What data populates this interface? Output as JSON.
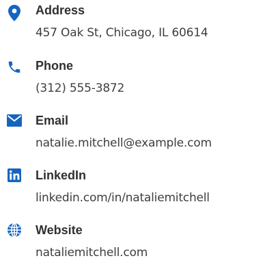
{
  "accent_color": "#1565c0",
  "items": [
    {
      "icon": "map-pin-icon",
      "label": "Address",
      "value": "457 Oak St, Chicago, IL 60614"
    },
    {
      "icon": "phone-icon",
      "label": "Phone",
      "value": "(312) 555-3872"
    },
    {
      "icon": "envelope-icon",
      "label": "Email",
      "value": "natalie.mitchell@example.com"
    },
    {
      "icon": "linkedin-icon",
      "label": "LinkedIn",
      "value": "linkedin.com/in/nataliemitchell"
    },
    {
      "icon": "globe-icon",
      "label": "Website",
      "value": "nataliemitchell.com"
    }
  ]
}
